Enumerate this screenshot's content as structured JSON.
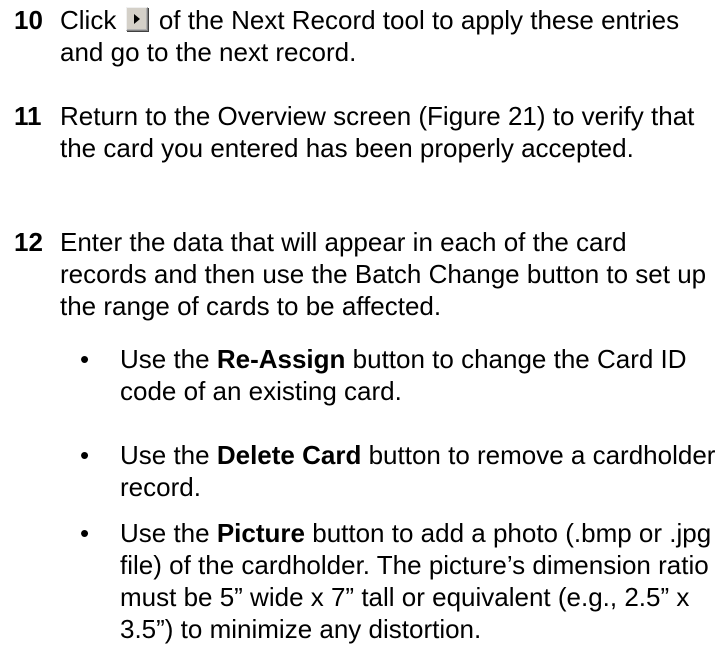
{
  "steps": [
    {
      "num": "10",
      "pre": "Click",
      "icon": "next-record-arrow-icon",
      "post": "of the Next Record tool to apply these entries and go to the next record."
    },
    {
      "num": "11",
      "text": "Return to the Overview screen (Figure 21) to verify that the card you entered has been properly accepted."
    },
    {
      "num": "12",
      "text": "Enter the data that will appear in each of the card records and then use the Batch Change button to set up the range of cards to be affected."
    }
  ],
  "bullets": [
    {
      "symbol": "•",
      "pre": "Use the",
      "bold": "Re-Assign",
      "post": "button to change the Card ID code of an existing card."
    },
    {
      "symbol": "•",
      "pre": "Use the",
      "bold": "Delete Card",
      "post": "button to remove a cardholder record."
    },
    {
      "symbol": "•",
      "pre": "Use the",
      "bold": "Picture",
      "post": "button to add a photo (.bmp or .jpg file) of the cardholder.  The picture’s dimension ratio must be 5” wide x 7” tall or equivalent (e.g., 2.5” x 3.5”) to minimize any distortion."
    }
  ]
}
